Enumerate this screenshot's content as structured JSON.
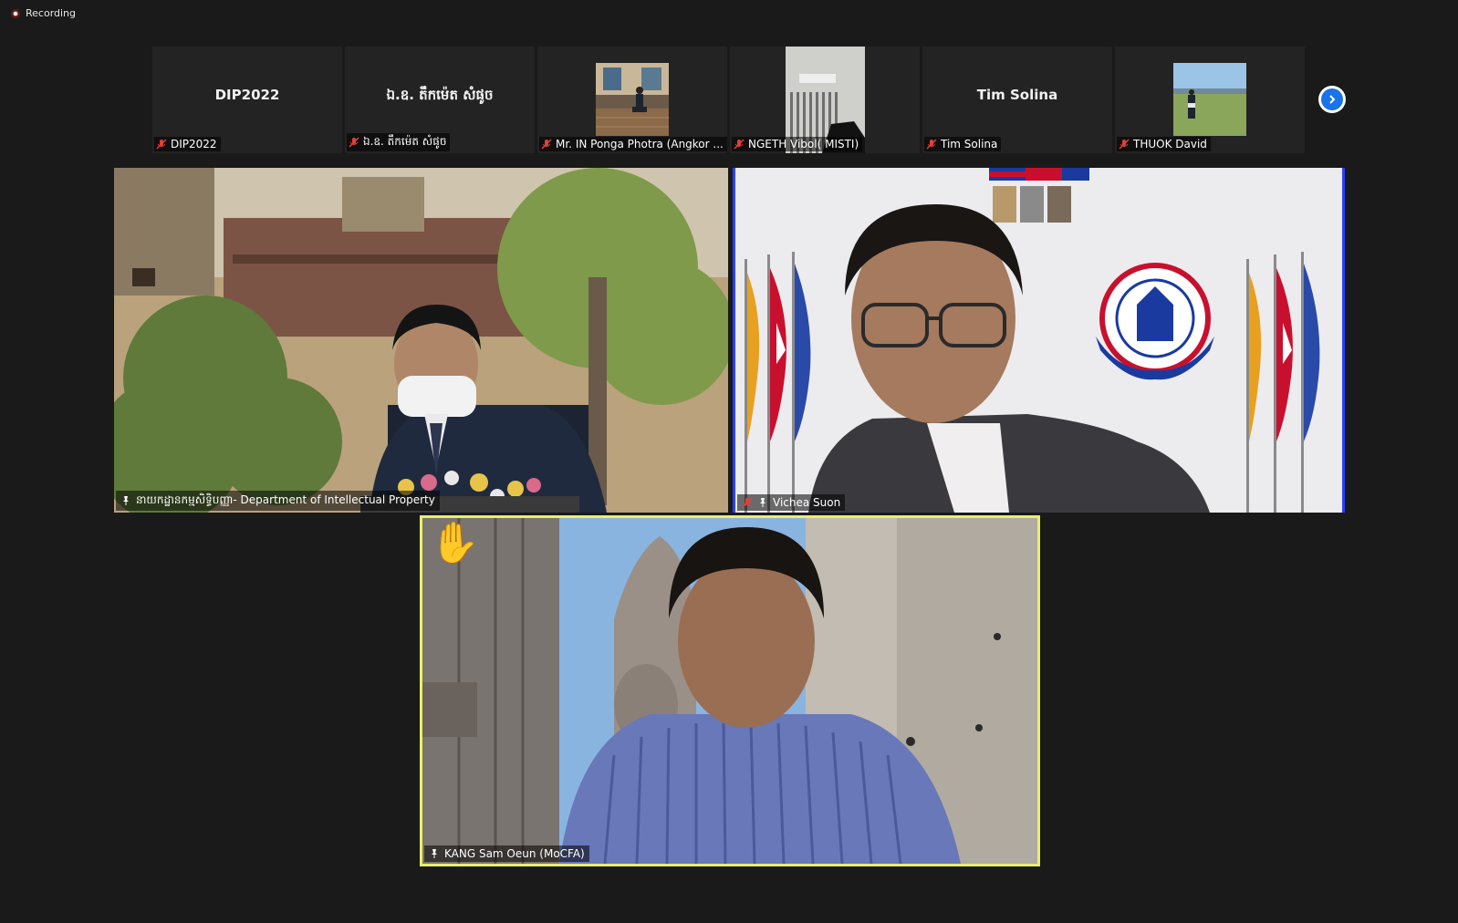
{
  "recording": {
    "label": "Recording"
  },
  "strip": {
    "tiles": [
      {
        "display": "DIP2022",
        "label": "DIP2022"
      },
      {
        "display": "ឯ.ឧ. តឹកម៉េត សំផូច",
        "label": "ឯ.ឧ. តឹកម៉េត សំផូច"
      },
      {
        "display": "",
        "label": "Mr. IN Ponga Photra (Angkor ..."
      },
      {
        "display": "",
        "label": "NGETH Vibol( MISTI)"
      },
      {
        "display": "Tim Solina",
        "label": "Tim Solina"
      },
      {
        "display": "",
        "label": "THUOK David"
      }
    ],
    "next_icon": "chevron-right-icon"
  },
  "videos": {
    "v1": {
      "name": "នាយកដ្ឋានកម្មសិទ្ធិបញ្ញា- Department of Intellectual Property"
    },
    "v2": {
      "name": "Vichea Suon"
    },
    "v3": {
      "name": "KANG Sam Oeun (MoCFA)",
      "reaction": "raised-hand"
    }
  },
  "colors": {
    "active_speaker": "#e8ef6e",
    "pinned_border": "#2a40ff",
    "mute": "#e0413a",
    "next_button": "#1a73e8"
  }
}
